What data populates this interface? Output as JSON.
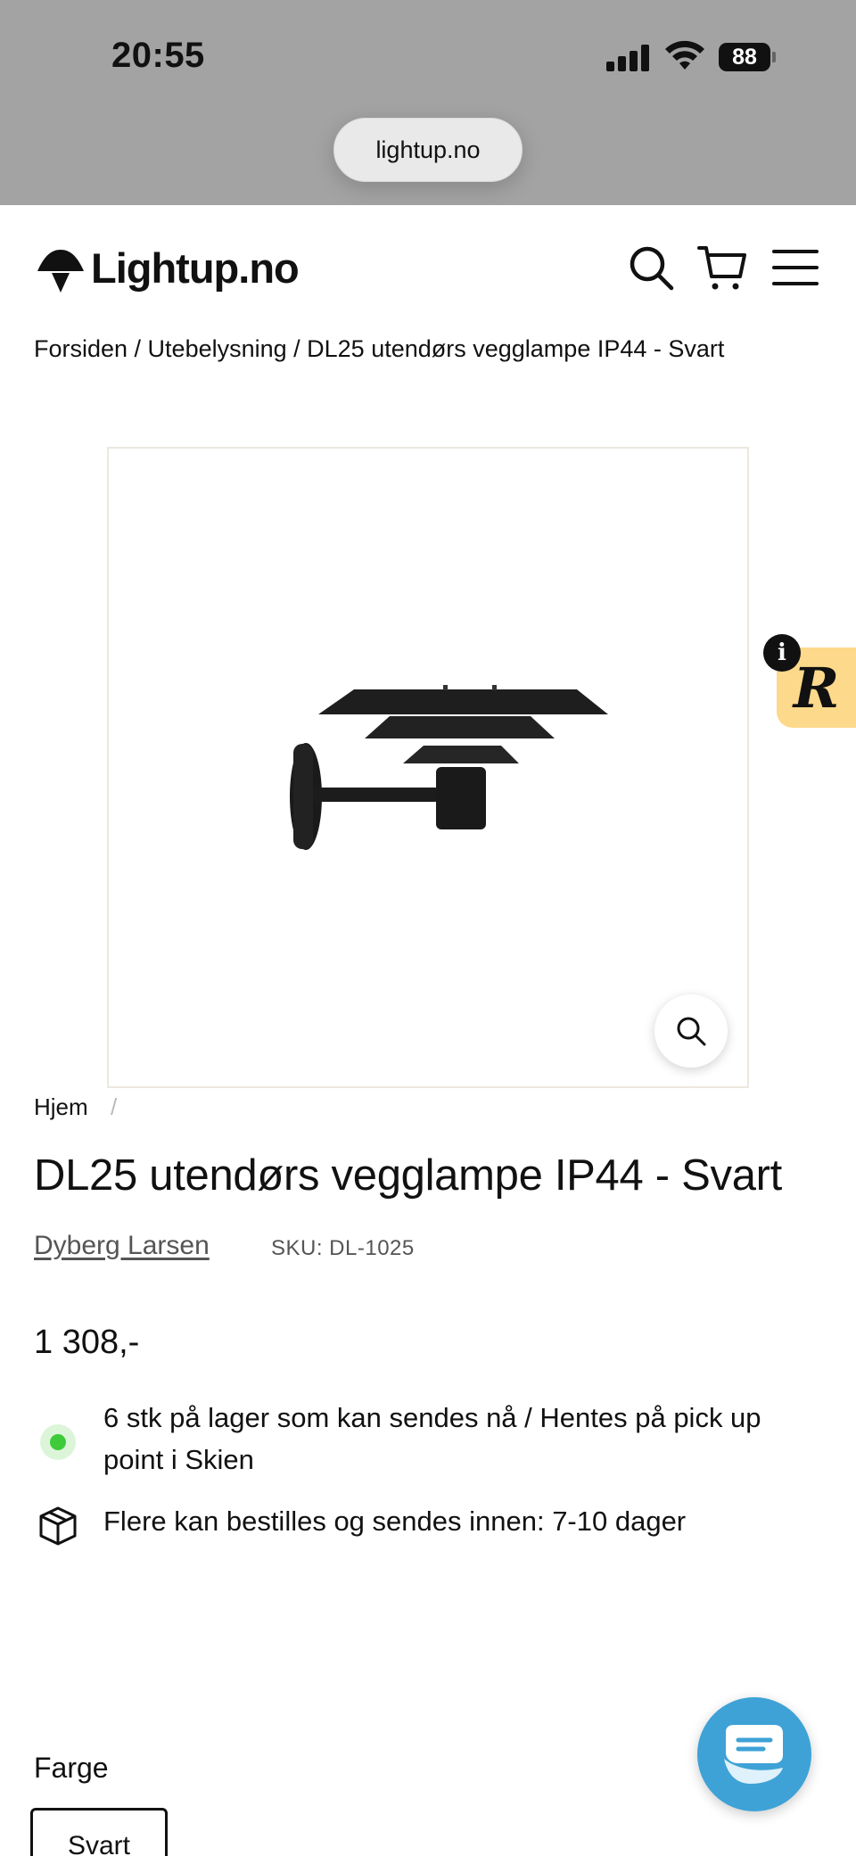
{
  "status_bar": {
    "time": "20:55",
    "battery": "88"
  },
  "browser": {
    "url": "lightup.no"
  },
  "header": {
    "logo_text": "Lightup.no",
    "icons": [
      "search-icon",
      "cart-icon",
      "menu-icon"
    ]
  },
  "breadcrumb": {
    "text": "Forsiden / Utebelysning / DL25 utendørs vegglampe IP44 - Svart"
  },
  "review_badge": {
    "info": "i",
    "letter": "R"
  },
  "mini_breadcrumb": {
    "home": "Hjem",
    "separator": "/"
  },
  "product": {
    "title": "DL25 utendørs vegglampe IP44 - Svart",
    "vendor": "Dyberg Larsen",
    "sku": "SKU: DL-1025",
    "price": "1 308,-",
    "stock": "6 stk på lager som kan sendes nå / Hentes på pick up point i Skien",
    "order_info": "Flere kan bestilles og sendes innen: 7-10 dager",
    "color_label": "Farge",
    "color_selected": "Svart"
  },
  "colors": {
    "stock_green": "#3ecb3a",
    "chat_blue": "#3ea2d6",
    "review_yellow": "#fcd98b"
  }
}
